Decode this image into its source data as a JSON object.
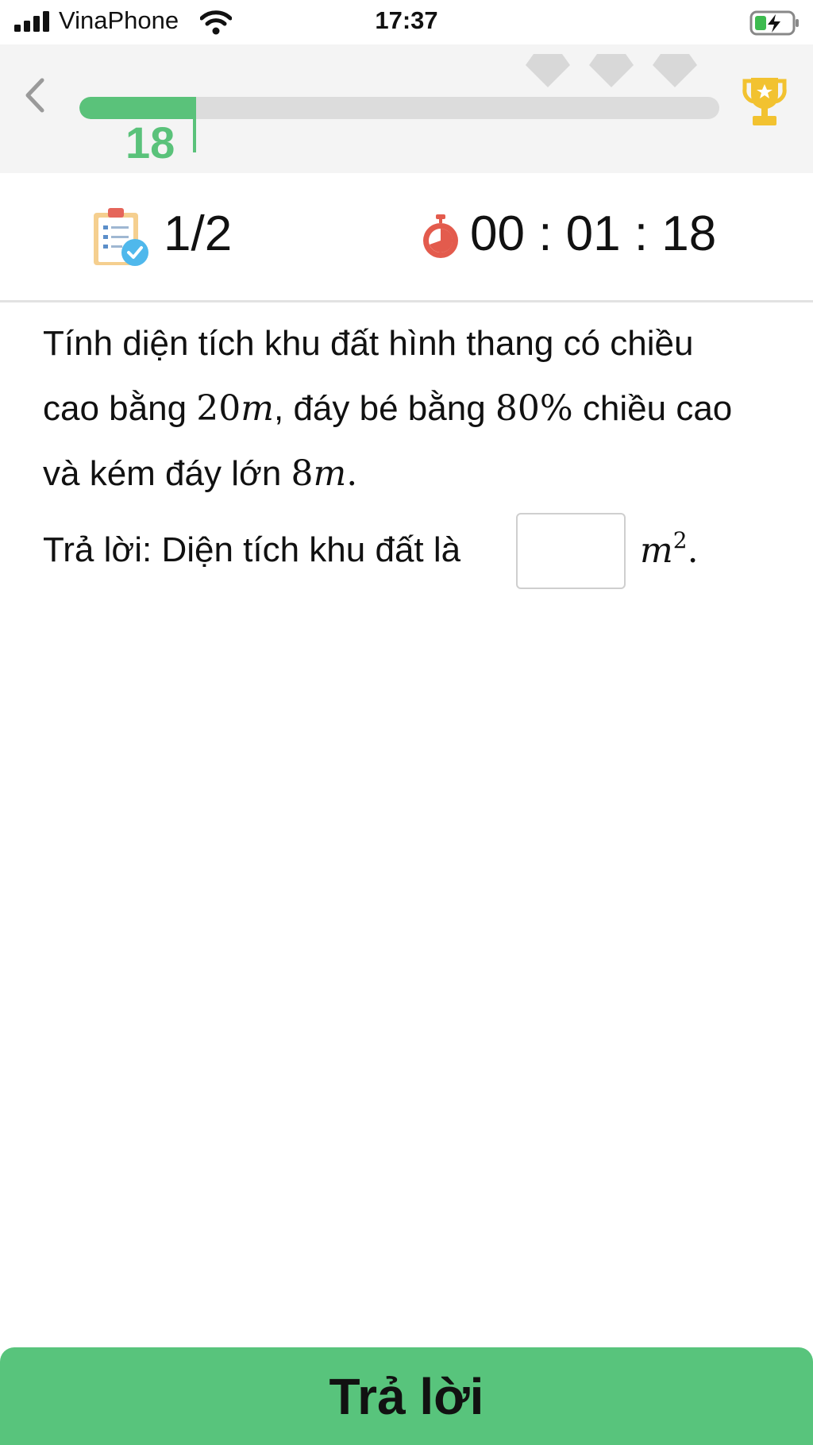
{
  "status_bar": {
    "carrier": "VinaPhone",
    "time": "17:37",
    "battery_state": "charging",
    "signal_icon": "signal-bars-icon",
    "wifi_icon": "wifi-icon",
    "battery_icon": "battery-charging-icon"
  },
  "header": {
    "back_icon": "chevron-left-icon",
    "progress_value": "18",
    "progress_fraction": 0.18,
    "gems": [
      "diamond-icon",
      "diamond-icon",
      "diamond-icon"
    ],
    "trophy_icon": "trophy-icon",
    "colors": {
      "progress": "#5ac27a",
      "track": "#dcdcdc",
      "gem": "#d8d8d8",
      "trophy": "#f2c230"
    }
  },
  "stats": {
    "quiz_icon": "quiz-clipboard-icon",
    "question_counter": "1/2",
    "timer_icon": "stopwatch-icon",
    "timer": "00 : 01 : 18"
  },
  "question": {
    "line1": "Tính diện tích khu đất hình thang có chiều",
    "line2_a": "cao bằng ",
    "line2_num": "20",
    "line2_var": "m",
    "line2_b": ", đáy bé bằng ",
    "line2_pct": "80%",
    "line2_c": " chiều cao",
    "line3_a": "và kém đáy lớn ",
    "line3_num": "8",
    "line3_var": "m",
    "line3_end": "."
  },
  "answer": {
    "label": "Trả lời: Diện tích khu đất là",
    "value": "",
    "unit_var": "m",
    "unit_exp": "2",
    "unit_end": "."
  },
  "submit": {
    "label": "Trả lời",
    "color": "#58c47c"
  }
}
